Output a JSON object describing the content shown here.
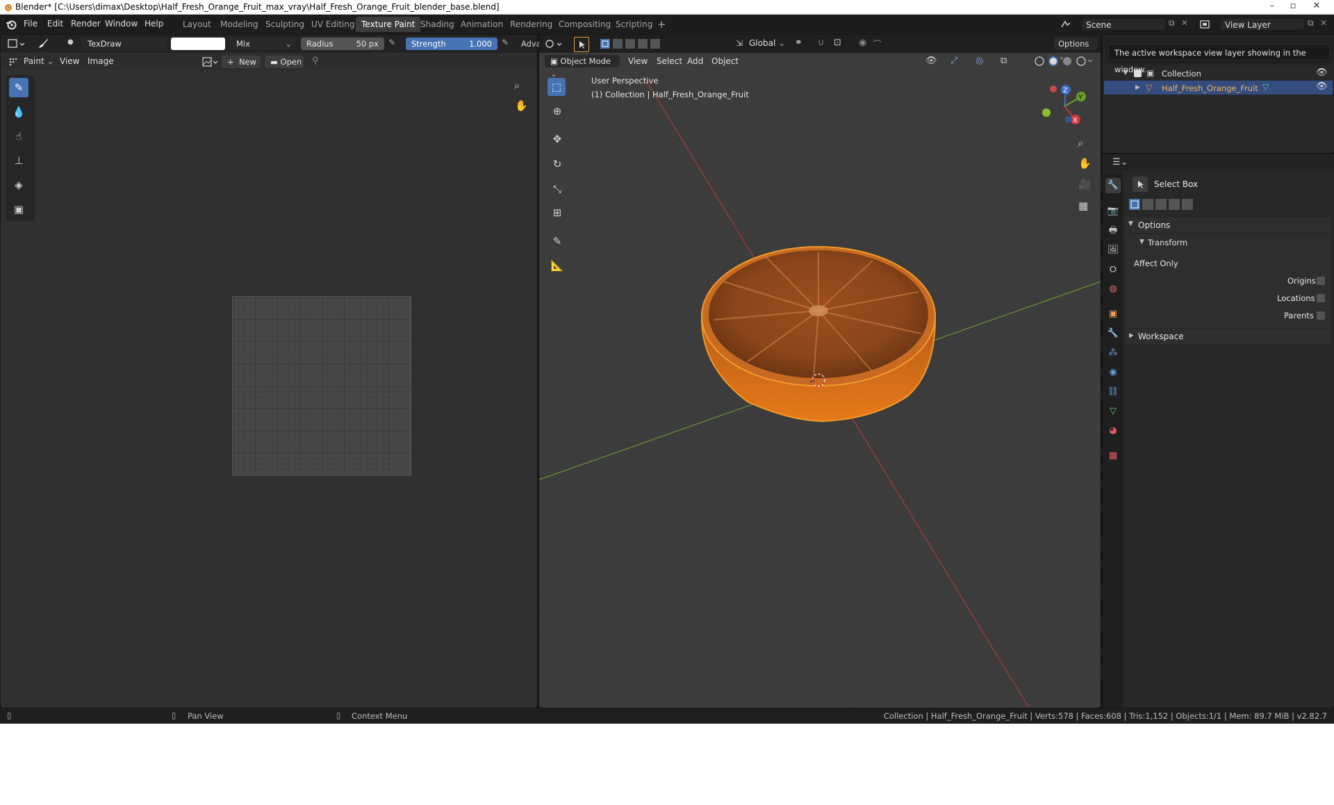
{
  "window": {
    "title": "Blender* [C:\\Users\\dimax\\Desktop\\Half_Fresh_Orange_Fruit_max_vray\\Half_Fresh_Orange_Fruit_blender_base.blend]"
  },
  "menu": [
    "File",
    "Edit",
    "Render",
    "Window",
    "Help"
  ],
  "workspaces": [
    "Layout",
    "Modeling",
    "Sculpting",
    "UV Editing",
    "Texture Paint",
    "Shading",
    "Animation",
    "Rendering",
    "Compositing",
    "Scripting"
  ],
  "active_workspace": "Texture Paint",
  "scene": {
    "name": "Scene",
    "view_layer": "View Layer"
  },
  "paint_header": {
    "brush_name": "TexDraw",
    "blend_mode": "Mix",
    "radius_label": "Radius",
    "radius_value": "50 px",
    "strength_label": "Strength",
    "strength_value": "1.000",
    "advanced_label": "Adva"
  },
  "image_header": {
    "mode": "Paint",
    "view": "View",
    "image": "Image",
    "new": "New",
    "open": "Open"
  },
  "viewport_header": {
    "orientation": "Global",
    "options": "Options",
    "mode": "Object Mode",
    "view": "View",
    "select": "Select",
    "add": "Add",
    "object": "Object"
  },
  "viewport": {
    "perspective": "User Perspective",
    "collection_info": "(1) Collection | Half_Fresh_Orange_Fruit",
    "gizmo": {
      "x": "X",
      "y": "Y",
      "z": "Z"
    }
  },
  "outliner": {
    "collection": "Collection",
    "object": "Half_Fresh_Orange_Fruit"
  },
  "tooltip": "The active workspace view layer showing in the window.",
  "properties": {
    "tool_name": "Select Box",
    "options_panel": "Options",
    "transform_panel": "Transform",
    "affect_only": "Affect Only",
    "origins": "Origins",
    "locations": "Locations",
    "parents": "Parents",
    "workspace_panel": "Workspace"
  },
  "statusbar": {
    "pan_view": "Pan View",
    "context_menu": "Context Menu",
    "stats": "Collection | Half_Fresh_Orange_Fruit | Verts:578 | Faces:608 | Tris:1,152 | Objects:1/1 | Mem: 89.7 MiB | v2.82.7"
  },
  "colors": {
    "accent_blue": "#4772b3",
    "x_axis": "#a33a3a",
    "y_axis": "#6a8f2a",
    "orange_rind": "#d46a1a",
    "selection_outline": "#f39a2a"
  }
}
